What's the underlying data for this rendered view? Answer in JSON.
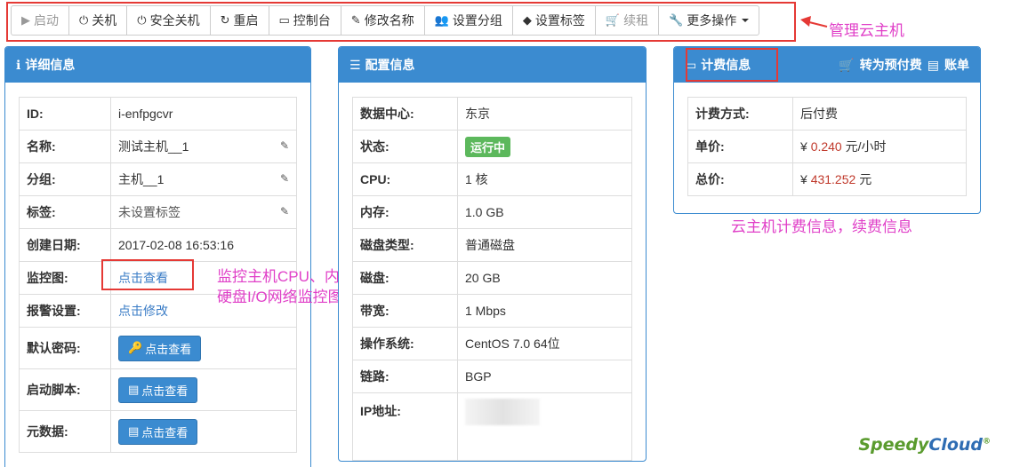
{
  "toolbar": {
    "start": "启动",
    "shutdown": "关机",
    "safe_shutdown": "安全关机",
    "restart": "重启",
    "console": "控制台",
    "rename": "修改名称",
    "set_group": "设置分组",
    "set_tag": "设置标签",
    "renew": "续租",
    "more": "更多操作"
  },
  "annotations": {
    "manage": "管理云主机",
    "monitor_line1": "监控主机CPU、内存、",
    "monitor_line2": "硬盘I/O网络监控图",
    "billing": "云主机计费信息，续费信息"
  },
  "detail": {
    "title": "详细信息",
    "rows": [
      {
        "label": "ID:",
        "value": "i-enfpgcvr"
      },
      {
        "label": "名称:",
        "value": "测试主机__1"
      },
      {
        "label": "分组:",
        "value": "主机__1"
      },
      {
        "label": "标签:",
        "value": "未设置标签"
      },
      {
        "label": "创建日期:",
        "value": "2017-02-08 16:53:16"
      },
      {
        "label": "监控图:",
        "value": "点击查看"
      },
      {
        "label": "报警设置:",
        "value": "点击修改"
      },
      {
        "label": "默认密码:",
        "value": "点击查看"
      },
      {
        "label": "启动脚本:",
        "value": "点击查看"
      },
      {
        "label": "元数据:",
        "value": "点击查看"
      }
    ]
  },
  "config": {
    "title": "配置信息",
    "rows": [
      {
        "label": "数据中心:",
        "value": "东京"
      },
      {
        "label": "状态:",
        "value": "运行中"
      },
      {
        "label": "CPU:",
        "value": "1 核"
      },
      {
        "label": "内存:",
        "value": "1.0 GB"
      },
      {
        "label": "磁盘类型:",
        "value": "普通磁盘"
      },
      {
        "label": "磁盘:",
        "value": "20 GB"
      },
      {
        "label": "带宽:",
        "value": "1 Mbps"
      },
      {
        "label": "操作系统:",
        "value": "CentOS 7.0 64位"
      },
      {
        "label": "链路:",
        "value": "BGP"
      },
      {
        "label": "IP地址:",
        "value": ""
      }
    ]
  },
  "billing": {
    "title": "计费信息",
    "to_prepaid": "转为预付费",
    "bill": "账单",
    "rows": [
      {
        "label": "计费方式:",
        "value": "后付费"
      },
      {
        "label": "单价:",
        "currency": "¥",
        "amount": "0.240",
        "unit": "元/小时"
      },
      {
        "label": "总价:",
        "currency": "¥",
        "amount": "431.252",
        "unit": "元"
      }
    ]
  },
  "logo": {
    "part1": "Speedy",
    "part2": "Cloud",
    "mark": "®"
  },
  "colors": {
    "primary": "#3b8bd0",
    "annotation": "#e040c8",
    "highlight": "#e53935",
    "success": "#5cb85c"
  }
}
